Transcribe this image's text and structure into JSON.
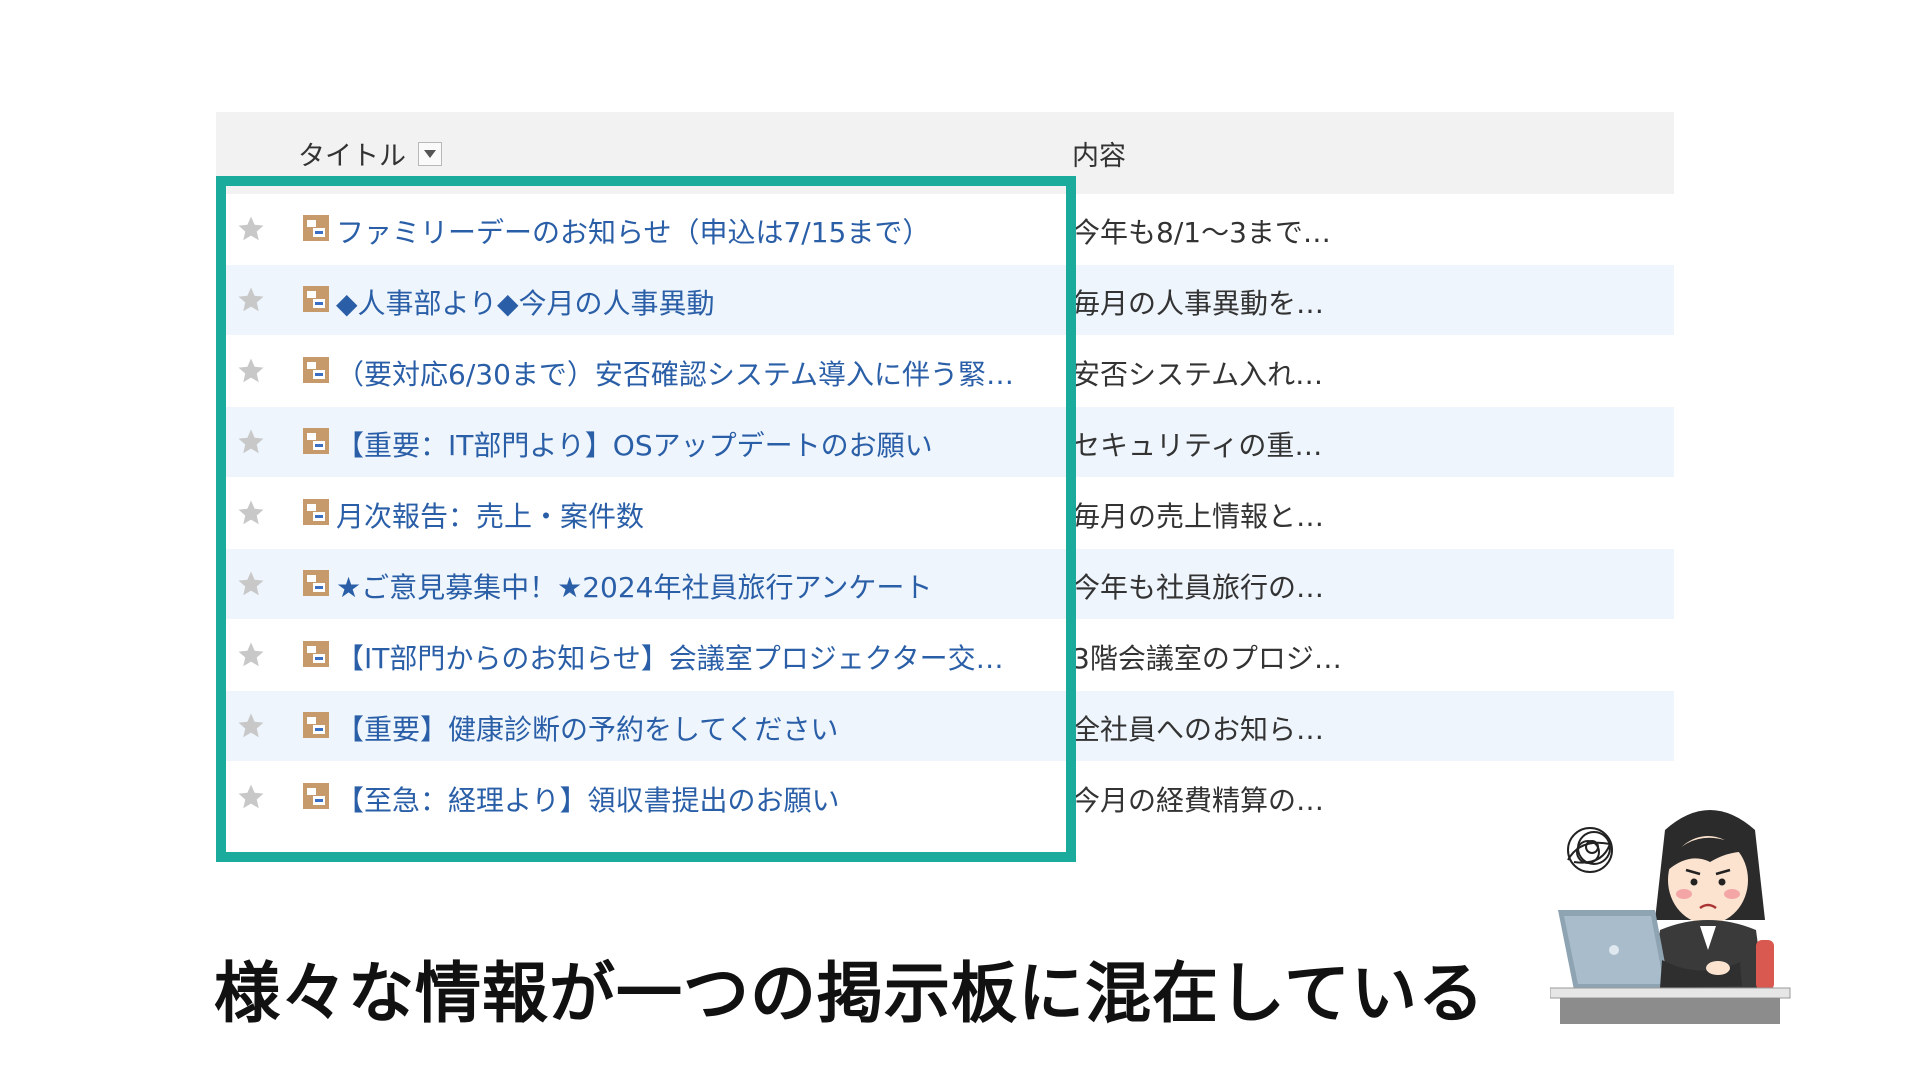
{
  "board": {
    "header": {
      "title_label": "タイトル",
      "content_label": "内容"
    },
    "rows": [
      {
        "title": "ファミリーデーのお知らせ（申込は7/15まで）",
        "content": "今年も8/1〜3まで…"
      },
      {
        "title": "◆人事部より◆今月の人事異動",
        "content": "毎月の人事異動を…"
      },
      {
        "title": "（要対応6/30まで）安否確認システム導入に伴う緊…",
        "content": "安否システム入れ…"
      },
      {
        "title": "【重要：IT部門より】OSアップデートのお願い",
        "content": "セキュリティの重…"
      },
      {
        "title": "月次報告：売上・案件数",
        "content": "毎月の売上情報と…"
      },
      {
        "title": "★ご意見募集中！★2024年社員旅行アンケート",
        "content": "今年も社員旅行の…"
      },
      {
        "title": "【IT部門からのお知らせ】会議室プロジェクター交…",
        "content": "3階会議室のプロジ…"
      },
      {
        "title": "【重要】健康診断の予約をしてください",
        "content": "全社員へのお知ら…"
      },
      {
        "title": "【至急：経理より】領収書提出のお願い",
        "content": "今月の経費精算の…"
      }
    ]
  },
  "caption": "様々な情報が一つの掲示板に混在している",
  "icons": {
    "star": "star-icon",
    "document": "document-icon",
    "sort": "sort-dropdown-icon"
  },
  "colors": {
    "highlight_border": "#1aab9c",
    "link": "#2a5fa8",
    "alt_row": "#eef5fc",
    "header_bg": "#f2f2f2"
  }
}
